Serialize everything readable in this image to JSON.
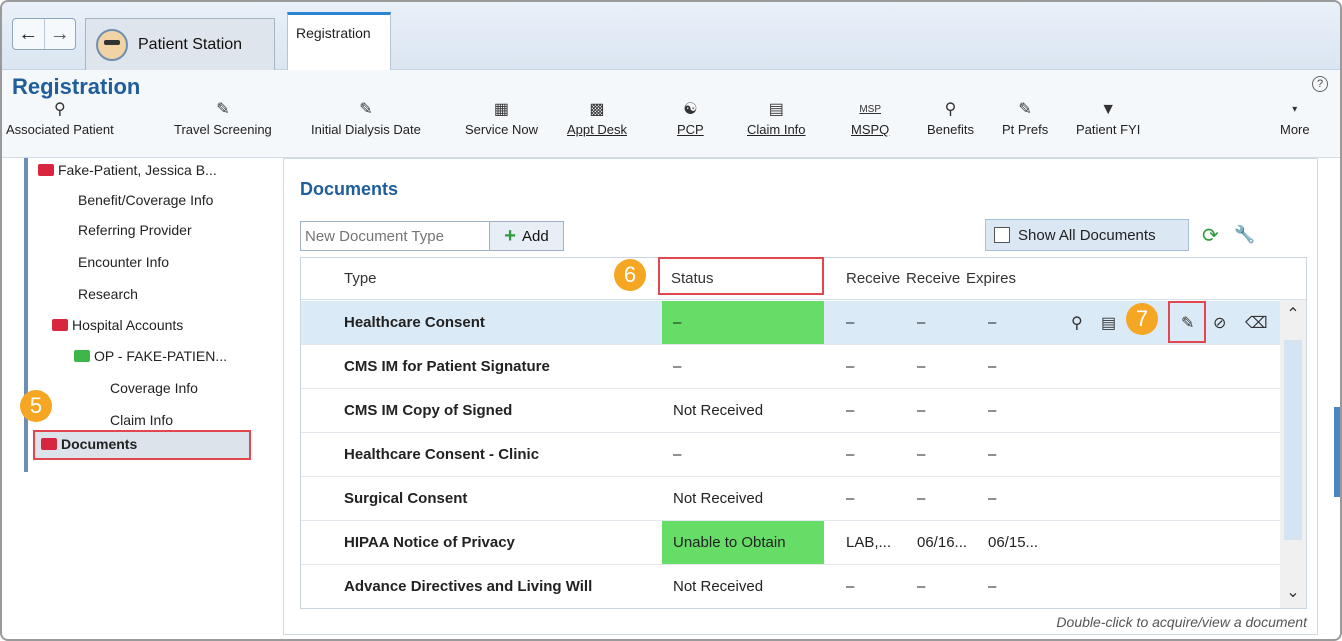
{
  "nav": {
    "back_icon": "back-arrow-icon",
    "forward_icon": "forward-arrow-icon"
  },
  "tabs": {
    "patient_station": "Patient Station",
    "registration": "Registration"
  },
  "header": {
    "title": "Registration",
    "help": "?"
  },
  "toolbar": [
    {
      "label": "Associated Patient",
      "icon": "search-icon"
    },
    {
      "label": "Travel Screening",
      "icon": "pencil-icon"
    },
    {
      "label": "Initial Dialysis Date",
      "icon": "pencil-icon"
    },
    {
      "label": "Service Now",
      "icon": "bars-icon"
    },
    {
      "label": "Appt Desk",
      "icon": "hierarchy-icon"
    },
    {
      "label": "PCP",
      "icon": "people-icon"
    },
    {
      "label": "Claim Info",
      "icon": "claim-icon"
    },
    {
      "label": "MSPQ",
      "icon": "msp-icon"
    },
    {
      "label": "Benefits",
      "icon": "benefits-icon"
    },
    {
      "label": "Pt Prefs",
      "icon": "pencil-icon"
    },
    {
      "label": "Patient FYI",
      "icon": "flag-icon"
    },
    {
      "label": "More",
      "icon": "chevron-down-icon"
    }
  ],
  "tree": {
    "patient": "Fake-Patient, Jessica B...",
    "items": [
      "Benefit/Coverage Info",
      "Referring Provider",
      "Encounter Info",
      "Research"
    ],
    "hospital_accounts": "Hospital Accounts",
    "op_account": "OP - FAKE-PATIEN...",
    "op_items": [
      "Coverage Info",
      "Claim Info"
    ],
    "documents": "Documents"
  },
  "documents": {
    "title": "Documents",
    "new_type_placeholder": "New Document Type",
    "add_label": "Add",
    "show_all_label": "Show All Documents",
    "columns": [
      "Type",
      "Status",
      "Receive",
      "Receive",
      "Expires"
    ],
    "rows": [
      {
        "type": "Healthcare Consent",
        "status": "–",
        "rec1": "–",
        "rec2": "–",
        "exp": "–"
      },
      {
        "type": "CMS IM for Patient Signature",
        "status": "–",
        "rec1": "–",
        "rec2": "–",
        "exp": "–"
      },
      {
        "type": "CMS IM Copy of Signed",
        "status": "Not Received",
        "rec1": "–",
        "rec2": "–",
        "exp": "–"
      },
      {
        "type": "Healthcare Consent - Clinic",
        "status": "–",
        "rec1": "–",
        "rec2": "–",
        "exp": "–"
      },
      {
        "type": "Surgical Consent",
        "status": "Not Received",
        "rec1": "–",
        "rec2": "–",
        "exp": "–"
      },
      {
        "type": "HIPAA Notice of Privacy",
        "status": "Unable to Obtain",
        "rec1": "LAB,...",
        "rec2": "06/16...",
        "exp": "06/15..."
      },
      {
        "type": "Advance Directives and Living Will",
        "status": "Not Received",
        "rec1": "–",
        "rec2": "–",
        "exp": "–"
      }
    ],
    "footer": "Double-click to acquire/view a document"
  },
  "callouts": [
    "5",
    "6",
    "7"
  ],
  "colors": {
    "accent": "#1f5d9b",
    "highlight": "#e2474f",
    "status_green": "#66dd66",
    "badge": "#f5a623"
  }
}
